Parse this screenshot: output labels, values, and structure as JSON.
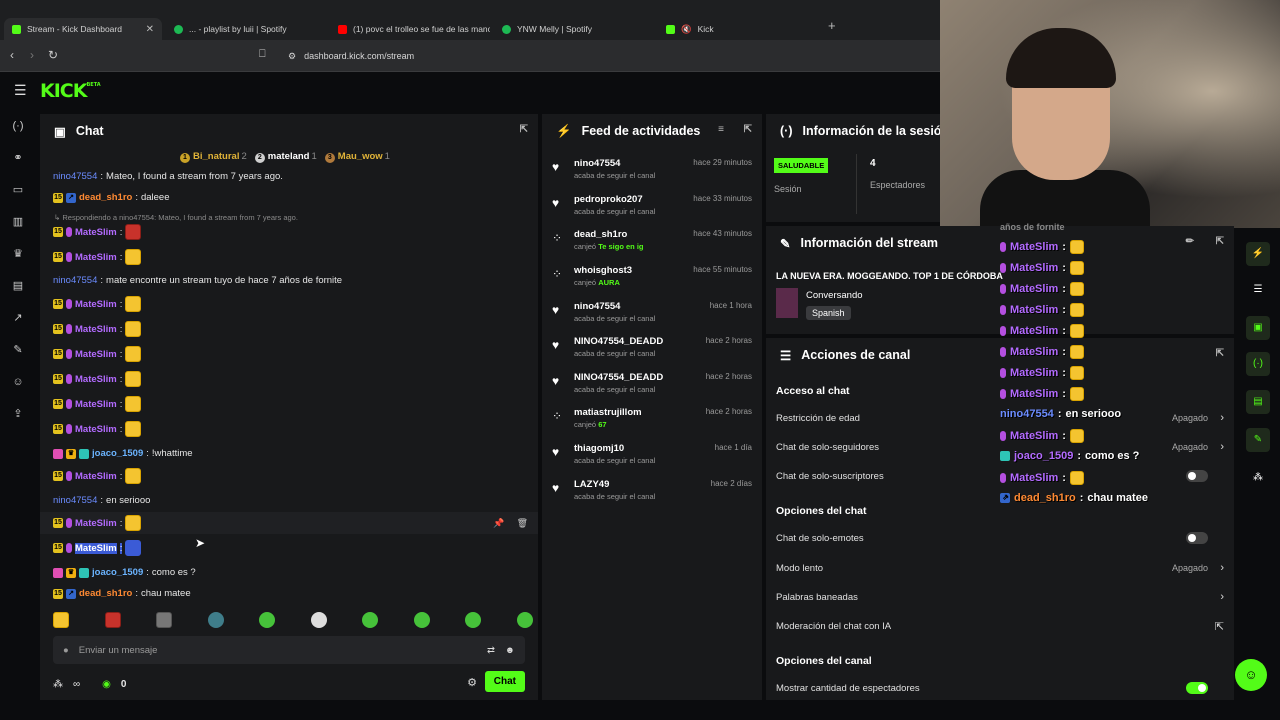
{
  "browser": {
    "tabs": [
      {
        "label": "Stream - Kick Dashboard",
        "color": "#53fc18"
      },
      {
        "label": "... - playlist by luii | Spotify",
        "color": "#1db954"
      },
      {
        "label": "(1) povc el trolleo se fue de las mano",
        "color": "#ff0000"
      },
      {
        "label": "YNW Melly | Spotify",
        "color": "#1db954"
      },
      {
        "label": "Kick",
        "color": "#53fc18"
      }
    ],
    "url": "dashboard.kick.com/stream"
  },
  "kick": {
    "logo": "KICK",
    "beta": "BETA"
  },
  "chat": {
    "title": "Chat",
    "top_gifters": [
      {
        "name": "Bi_natural",
        "count": "2",
        "rank": "1"
      },
      {
        "name": "mateland",
        "count": "1",
        "rank": "2"
      },
      {
        "name": "Mau_wow",
        "count": "1",
        "rank": "3"
      }
    ],
    "messages": [
      {
        "user": "nino47554",
        "sep": ":",
        "text": "Mateo, I found a stream from 7 years ago."
      },
      {
        "user": "dead_sh1ro",
        "sep": ":",
        "text": "daleee"
      },
      {
        "reply": "Respondiendo a nino47554: Mateo, I found a stream from 7 years ago."
      },
      {
        "user": "MateSlim",
        "sep": ":"
      },
      {
        "user": "MateSlim",
        "sep": ":"
      },
      {
        "user": "nino47554",
        "sep": ":",
        "text": "mate encontre un stream tuyo de hace 7 años de fornite"
      },
      {
        "user": "MateSlim",
        "sep": ":"
      },
      {
        "user": "MateSlim",
        "sep": ":"
      },
      {
        "user": "MateSlim",
        "sep": ":"
      },
      {
        "user": "MateSlim",
        "sep": ":"
      },
      {
        "user": "MateSlim",
        "sep": ":"
      },
      {
        "user": "MateSlim",
        "sep": ":"
      },
      {
        "user": "joaco_1509",
        "sep": ":",
        "text": "!whattime"
      },
      {
        "user": "MateSlim",
        "sep": ":"
      },
      {
        "user": "nino47554",
        "sep": ":",
        "text": "en seriooo"
      },
      {
        "user": "MateSlim",
        "sep": ":"
      },
      {
        "user": "MateSlim",
        "sep": ":"
      },
      {
        "user": "joaco_1509",
        "sep": ":",
        "text": "como es ?"
      },
      {
        "user": "dead_sh1ro",
        "sep": ":",
        "text": "chau matee"
      }
    ],
    "input_placeholder": "Enviar un mensaje",
    "viewers_infinity": "∞",
    "points": "0",
    "send_label": "Chat"
  },
  "feed": {
    "title": "Feed de actividades",
    "items": [
      {
        "name": "nino47554",
        "sub": "acaba de seguir el canal",
        "time": "hace 29 minutos",
        "icon": "heart"
      },
      {
        "name": "pedroproko207",
        "sub": "acaba de seguir el canal",
        "time": "hace 33 minutos",
        "icon": "heart"
      },
      {
        "name": "dead_sh1ro",
        "sub": "canjeó",
        "reward": "Te sigo en ig",
        "time": "hace 43 minutos",
        "icon": "redeem"
      },
      {
        "name": "whoisghost3",
        "sub": "canjeó",
        "reward": "AURA",
        "time": "hace 55 minutos",
        "icon": "redeem"
      },
      {
        "name": "nino47554",
        "sub": "acaba de seguir el canal",
        "time": "hace 1 hora",
        "icon": "heart"
      },
      {
        "name": "NINO47554_DEADD",
        "sub": "acaba de seguir el canal",
        "time": "hace 2 horas",
        "icon": "heart"
      },
      {
        "name": "NINO47554_DEADD",
        "sub": "acaba de seguir el canal",
        "time": "hace 2 horas",
        "icon": "heart"
      },
      {
        "name": "matiastrujillom",
        "sub": "canjeó",
        "reward": "67",
        "time": "hace 2 horas",
        "icon": "redeem"
      },
      {
        "name": "thiagomj10",
        "sub": "acaba de seguir el canal",
        "time": "hace 1 día",
        "icon": "heart"
      },
      {
        "name": "LAZY49",
        "sub": "acaba de seguir el canal",
        "time": "hace 2 días",
        "icon": "heart"
      }
    ]
  },
  "session": {
    "title": "Información de la sesió",
    "health": "SALUDABLE",
    "session_label": "Sesión",
    "viewers": "4",
    "viewers_label": "Espectadores"
  },
  "stream_info": {
    "title": "Información del stream",
    "stream_title": "LA NUEVA ERA. MOGGEANDO. TOP 1 DE CÓRDOBA",
    "category": "Conversando",
    "language": "Spanish"
  },
  "actions": {
    "title": "Acciones de canal",
    "sections": {
      "access": "Acceso al chat",
      "chat_options": "Opciones del chat",
      "channel_options": "Opciones del canal"
    },
    "rows": {
      "age": {
        "label": "Restricción de edad",
        "value": "Apagado"
      },
      "followers": {
        "label": "Chat de solo-seguidores",
        "value": "Apagado"
      },
      "subs": {
        "label": "Chat de solo-suscriptores"
      },
      "emotes": {
        "label": "Chat de solo-emotes"
      },
      "slow": {
        "label": "Modo lento",
        "value": "Apagado"
      },
      "banned": {
        "label": "Palabras baneadas"
      },
      "ai": {
        "label": "Moderación del chat con IA"
      },
      "viewercount": {
        "label": "Mostrar cantidad de espectadores"
      }
    }
  },
  "overlay": {
    "top_text": "años de fornite",
    "messages": [
      {
        "user": "MateSlim",
        "sep": ":"
      },
      {
        "user": "MateSlim",
        "sep": ":"
      },
      {
        "user": "MateSlim",
        "sep": ":"
      },
      {
        "user": "MateSlim",
        "sep": ":"
      },
      {
        "user": "MateSlim",
        "sep": ":"
      },
      {
        "user": "MateSlim",
        "sep": ":"
      },
      {
        "user": "MateSlim",
        "sep": ":"
      },
      {
        "user": "MateSlim",
        "sep": ":"
      },
      {
        "user": "nino47554",
        "sep": ":",
        "text": "en seriooo"
      },
      {
        "user": "MateSlim",
        "sep": ":"
      },
      {
        "user": "joaco_1509",
        "sep": ":",
        "text": "como es ?"
      },
      {
        "user": "MateSlim",
        "sep": ":"
      },
      {
        "user": "dead_sh1ro",
        "sep": ":",
        "text": "chau matee"
      }
    ]
  }
}
